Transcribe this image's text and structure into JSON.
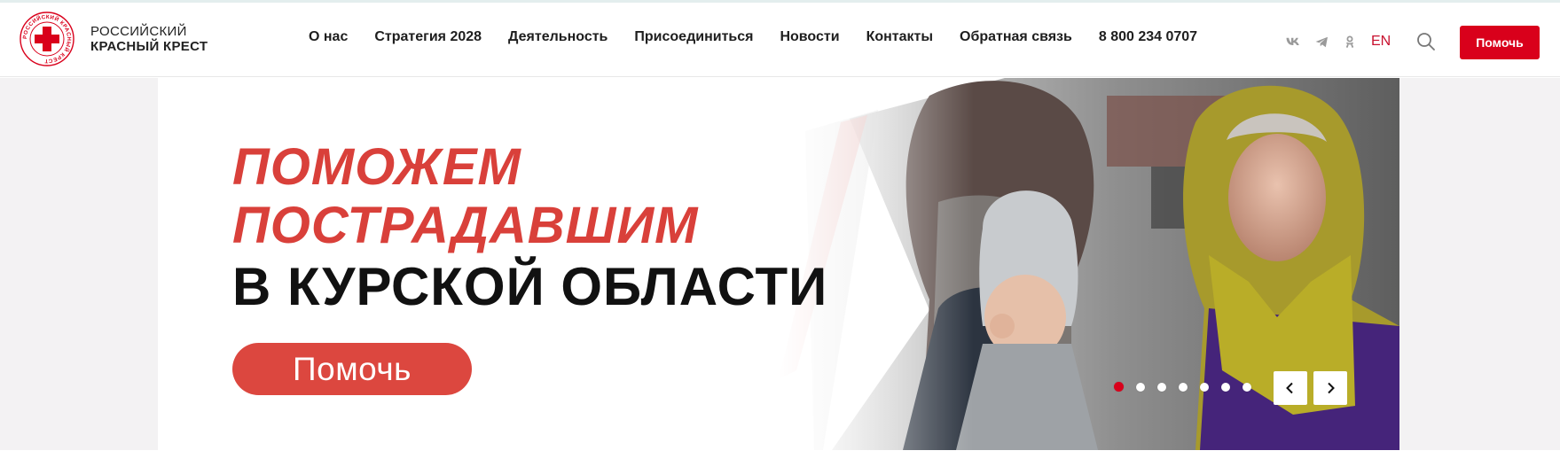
{
  "logo": {
    "line1": "РОССИЙСКИЙ",
    "line2": "КРАСНЫЙ КРЕСТ",
    "emblem_text": "РОССИЙСКИЙ КРАСНЫЙ КРЕСТ",
    "icon": "red-cross-emblem",
    "color": "#d9001b"
  },
  "nav": {
    "items": [
      "О нас",
      "Стратегия 2028",
      "Деятельность",
      "Присоединиться",
      "Новости",
      "Контакты",
      "Обратная связь"
    ],
    "phone": "8 800 234 0707"
  },
  "socials": [
    {
      "name": "vk",
      "icon": "vk-icon"
    },
    {
      "name": "telegram",
      "icon": "telegram-icon"
    },
    {
      "name": "odnoklassniki",
      "icon": "odnoklassniki-icon"
    }
  ],
  "lang": "EN",
  "search": {
    "icon": "search-icon"
  },
  "header_help_label": "Помочь",
  "hero": {
    "line1": "ПОМОЖЕМ",
    "line2": "ПОСТРАДАВШИМ",
    "line3": "В КУРСКОЙ ОБЛАСТИ",
    "cta_label": "Помочь",
    "slides_count": 7,
    "active_slide": 1,
    "accent_color": "#dc473f",
    "prev_icon": "chevron-left-icon",
    "next_icon": "chevron-right-icon"
  }
}
